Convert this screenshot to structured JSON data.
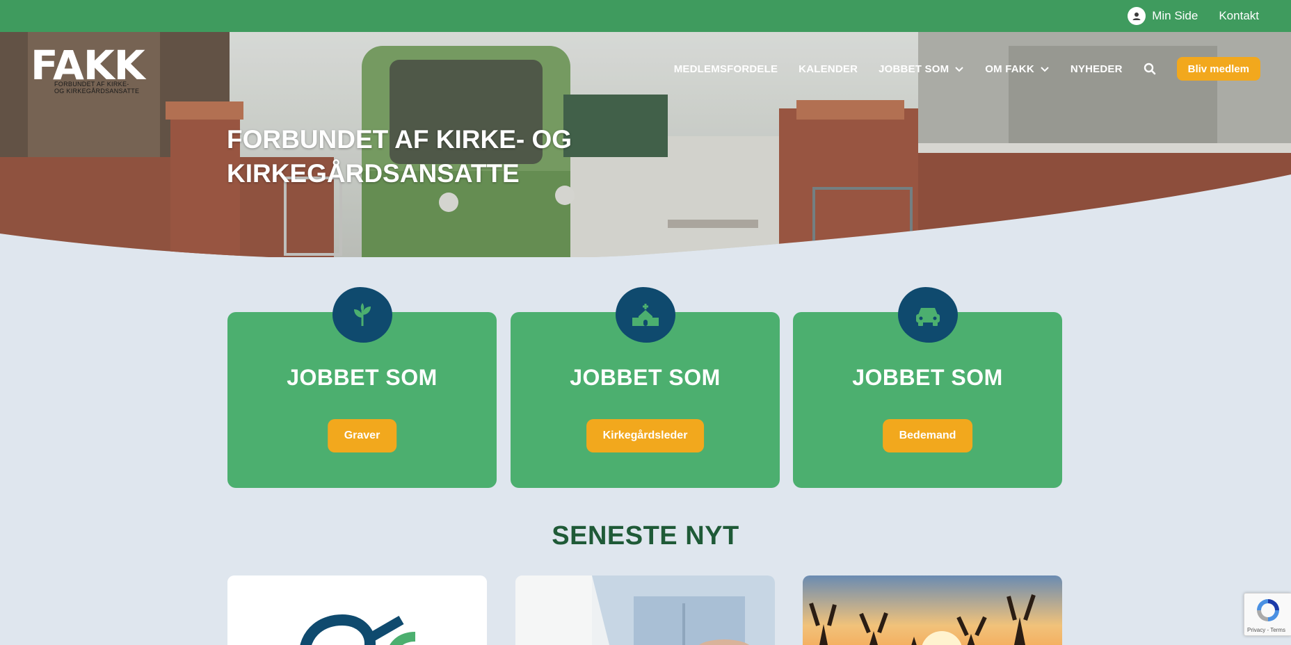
{
  "topbar": {
    "min_side": "Min Side",
    "kontakt": "Kontakt"
  },
  "logo": {
    "word": "FAKK",
    "sub_line1": "FORBUNDET AF KIRKE-",
    "sub_line2": "OG KIRKEGÅRDSANSATTE"
  },
  "nav": {
    "items": [
      {
        "label": "MEDLEMSFORDELE",
        "dropdown": false
      },
      {
        "label": "KALENDER",
        "dropdown": false
      },
      {
        "label": "JOBBET SOM",
        "dropdown": true
      },
      {
        "label": "OM FAKK",
        "dropdown": true
      },
      {
        "label": "NYHEDER",
        "dropdown": false
      }
    ],
    "search_icon": "search-icon",
    "cta": "Bliv medlem"
  },
  "hero": {
    "title_line1": "FORBUNDET AF KIRKE- OG",
    "title_line2": "KIRKEGÅRDSANSATTE"
  },
  "cards": [
    {
      "title": "JOBBET SOM",
      "button": "Graver",
      "icon": "plant-icon"
    },
    {
      "title": "JOBBET SOM",
      "button": "Kirkegårdsleder",
      "icon": "church-icon"
    },
    {
      "title": "JOBBET SOM",
      "button": "Bedemand",
      "icon": "car-icon"
    }
  ],
  "news_section": {
    "title": "SENESTE NYT"
  },
  "recaptcha": {
    "text": "Privacy - Terms"
  },
  "colors": {
    "green_bar": "#3f9b5e",
    "card_green": "#4caf6f",
    "badge_blue": "#0f4a6e",
    "accent_yellow": "#f2a81d",
    "page_bg": "#dfe6ee",
    "heading_green": "#1f5a37"
  }
}
